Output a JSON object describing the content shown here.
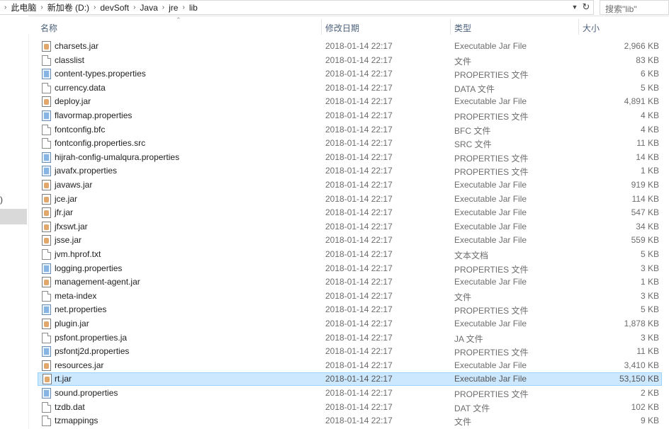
{
  "breadcrumb": [
    "此电脑",
    "新加卷 (D:)",
    "devSoft",
    "Java",
    "jre",
    "lib"
  ],
  "search": {
    "placeholder": "搜索\"lib\""
  },
  "nav": {
    "fragment": ")"
  },
  "columns": {
    "name": "名称",
    "date": "修改日期",
    "type": "类型",
    "size": "大小"
  },
  "files": [
    {
      "name": "charsets.jar",
      "date": "2018-01-14 22:17",
      "type": "Executable Jar File",
      "size": "2,966 KB",
      "icon": "jar-icon"
    },
    {
      "name": "classlist",
      "date": "2018-01-14 22:17",
      "type": "文件",
      "size": "83 KB",
      "icon": "file-icon"
    },
    {
      "name": "content-types.properties",
      "date": "2018-01-14 22:17",
      "type": "PROPERTIES 文件",
      "size": "6 KB",
      "icon": "properties-icon"
    },
    {
      "name": "currency.data",
      "date": "2018-01-14 22:17",
      "type": "DATA 文件",
      "size": "5 KB",
      "icon": "file-icon"
    },
    {
      "name": "deploy.jar",
      "date": "2018-01-14 22:17",
      "type": "Executable Jar File",
      "size": "4,891 KB",
      "icon": "jar-icon"
    },
    {
      "name": "flavormap.properties",
      "date": "2018-01-14 22:17",
      "type": "PROPERTIES 文件",
      "size": "4 KB",
      "icon": "properties-icon"
    },
    {
      "name": "fontconfig.bfc",
      "date": "2018-01-14 22:17",
      "type": "BFC 文件",
      "size": "4 KB",
      "icon": "file-icon"
    },
    {
      "name": "fontconfig.properties.src",
      "date": "2018-01-14 22:17",
      "type": "SRC 文件",
      "size": "11 KB",
      "icon": "file-icon"
    },
    {
      "name": "hijrah-config-umalqura.properties",
      "date": "2018-01-14 22:17",
      "type": "PROPERTIES 文件",
      "size": "14 KB",
      "icon": "properties-icon"
    },
    {
      "name": "javafx.properties",
      "date": "2018-01-14 22:17",
      "type": "PROPERTIES 文件",
      "size": "1 KB",
      "icon": "properties-icon"
    },
    {
      "name": "javaws.jar",
      "date": "2018-01-14 22:17",
      "type": "Executable Jar File",
      "size": "919 KB",
      "icon": "jar-icon"
    },
    {
      "name": "jce.jar",
      "date": "2018-01-14 22:17",
      "type": "Executable Jar File",
      "size": "114 KB",
      "icon": "jar-icon"
    },
    {
      "name": "jfr.jar",
      "date": "2018-01-14 22:17",
      "type": "Executable Jar File",
      "size": "547 KB",
      "icon": "jar-icon"
    },
    {
      "name": "jfxswt.jar",
      "date": "2018-01-14 22:17",
      "type": "Executable Jar File",
      "size": "34 KB",
      "icon": "jar-icon"
    },
    {
      "name": "jsse.jar",
      "date": "2018-01-14 22:17",
      "type": "Executable Jar File",
      "size": "559 KB",
      "icon": "jar-icon"
    },
    {
      "name": "jvm.hprof.txt",
      "date": "2018-01-14 22:17",
      "type": "文本文档",
      "size": "5 KB",
      "icon": "file-icon"
    },
    {
      "name": "logging.properties",
      "date": "2018-01-14 22:17",
      "type": "PROPERTIES 文件",
      "size": "3 KB",
      "icon": "properties-icon"
    },
    {
      "name": "management-agent.jar",
      "date": "2018-01-14 22:17",
      "type": "Executable Jar File",
      "size": "1 KB",
      "icon": "jar-icon"
    },
    {
      "name": "meta-index",
      "date": "2018-01-14 22:17",
      "type": "文件",
      "size": "3 KB",
      "icon": "file-icon"
    },
    {
      "name": "net.properties",
      "date": "2018-01-14 22:17",
      "type": "PROPERTIES 文件",
      "size": "5 KB",
      "icon": "properties-icon"
    },
    {
      "name": "plugin.jar",
      "date": "2018-01-14 22:17",
      "type": "Executable Jar File",
      "size": "1,878 KB",
      "icon": "jar-icon"
    },
    {
      "name": "psfont.properties.ja",
      "date": "2018-01-14 22:17",
      "type": "JA 文件",
      "size": "3 KB",
      "icon": "file-icon"
    },
    {
      "name": "psfontj2d.properties",
      "date": "2018-01-14 22:17",
      "type": "PROPERTIES 文件",
      "size": "11 KB",
      "icon": "properties-icon"
    },
    {
      "name": "resources.jar",
      "date": "2018-01-14 22:17",
      "type": "Executable Jar File",
      "size": "3,410 KB",
      "icon": "jar-icon"
    },
    {
      "name": "rt.jar",
      "date": "2018-01-14 22:17",
      "type": "Executable Jar File",
      "size": "53,150 KB",
      "icon": "jar-icon",
      "selected": true
    },
    {
      "name": "sound.properties",
      "date": "2018-01-14 22:17",
      "type": "PROPERTIES 文件",
      "size": "2 KB",
      "icon": "properties-icon"
    },
    {
      "name": "tzdb.dat",
      "date": "2018-01-14 22:17",
      "type": "DAT 文件",
      "size": "102 KB",
      "icon": "file-icon"
    },
    {
      "name": "tzmappings",
      "date": "2018-01-14 22:17",
      "type": "文件",
      "size": "9 KB",
      "icon": "file-icon"
    }
  ],
  "colors": {
    "selection_bg": "#cce8ff",
    "selection_border": "#99d1ff",
    "header_text": "#4c607a"
  }
}
